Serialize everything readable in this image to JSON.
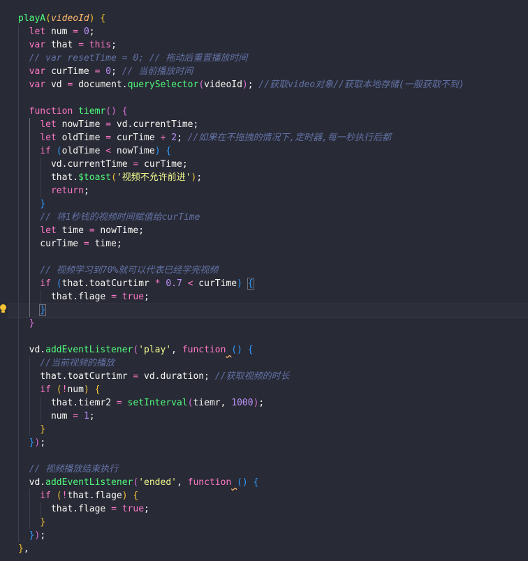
{
  "editor": {
    "code_lines": [
      [
        [
          "fn",
          "playA"
        ],
        [
          "bk-y",
          "("
        ],
        [
          "prm",
          "videoId"
        ],
        [
          "bk-y",
          ")"
        ],
        [
          "pn",
          " "
        ],
        [
          "bk-y",
          "{"
        ]
      ],
      [
        [
          "pn",
          "  "
        ],
        [
          "kw",
          "let"
        ],
        [
          "pn",
          " num "
        ],
        [
          "op",
          "="
        ],
        [
          "pn",
          " "
        ],
        [
          "num",
          "0"
        ],
        [
          "pn",
          ";"
        ]
      ],
      [
        [
          "pn",
          "  "
        ],
        [
          "kw",
          "var"
        ],
        [
          "pn",
          " that "
        ],
        [
          "op",
          "="
        ],
        [
          "pn",
          " "
        ],
        [
          "kw",
          "this"
        ],
        [
          "pn",
          ";"
        ]
      ],
      [
        [
          "pn",
          "  "
        ],
        [
          "cm",
          "// var resetTime = 0; // 拖动后重置播放时间"
        ]
      ],
      [
        [
          "pn",
          "  "
        ],
        [
          "kw",
          "var"
        ],
        [
          "pn",
          " curTime "
        ],
        [
          "op",
          "="
        ],
        [
          "pn",
          " "
        ],
        [
          "num",
          "0"
        ],
        [
          "pn",
          "; "
        ],
        [
          "cm",
          "// 当前播放时间"
        ]
      ],
      [
        [
          "pn",
          "  "
        ],
        [
          "kw",
          "var"
        ],
        [
          "pn",
          " vd "
        ],
        [
          "op",
          "="
        ],
        [
          "pn",
          " document."
        ],
        [
          "met",
          "querySelector"
        ],
        [
          "bk-p",
          "("
        ],
        [
          "pn",
          "videoId"
        ],
        [
          "bk-p",
          ")"
        ],
        [
          "pn",
          "; "
        ],
        [
          "cm",
          "//获取video对象//获取本地存储(一般获取不到)"
        ]
      ],
      [],
      [
        [
          "pn",
          "  "
        ],
        [
          "kw",
          "function"
        ],
        [
          "pn",
          " "
        ],
        [
          "fn",
          "tiemr"
        ],
        [
          "bk-p",
          "()"
        ],
        [
          "pn",
          " "
        ],
        [
          "bk-p",
          "{"
        ]
      ],
      [
        [
          "pn",
          "    "
        ],
        [
          "kw",
          "let"
        ],
        [
          "pn",
          " nowTime "
        ],
        [
          "op",
          "="
        ],
        [
          "pn",
          " vd."
        ],
        [
          "pr",
          "currentTime"
        ],
        [
          "pn",
          ";"
        ]
      ],
      [
        [
          "pn",
          "    "
        ],
        [
          "kw",
          "let"
        ],
        [
          "pn",
          " oldTime "
        ],
        [
          "op",
          "="
        ],
        [
          "pn",
          " curTime "
        ],
        [
          "op",
          "+"
        ],
        [
          "pn",
          " "
        ],
        [
          "num",
          "2"
        ],
        [
          "pn",
          "; "
        ],
        [
          "cm",
          "//如果在不拖拽的情况下,定时器,每一秒执行后都"
        ]
      ],
      [
        [
          "pn",
          "    "
        ],
        [
          "kw",
          "if"
        ],
        [
          "pn",
          " "
        ],
        [
          "bk-b",
          "("
        ],
        [
          "pn",
          "oldTime "
        ],
        [
          "op",
          "<"
        ],
        [
          "pn",
          " nowTime"
        ],
        [
          "bk-b",
          ")"
        ],
        [
          "pn",
          " "
        ],
        [
          "bk-b",
          "{"
        ]
      ],
      [
        [
          "pn",
          "      vd."
        ],
        [
          "pr",
          "currentTime"
        ],
        [
          "pn",
          " "
        ],
        [
          "op",
          "="
        ],
        [
          "pn",
          " curTime;"
        ]
      ],
      [
        [
          "pn",
          "      that."
        ],
        [
          "met",
          "$toast"
        ],
        [
          "bk-y",
          "("
        ],
        [
          "str",
          "'视频不允许前进'"
        ],
        [
          "bk-y",
          ")"
        ],
        [
          "pn",
          ";"
        ]
      ],
      [
        [
          "pn",
          "      "
        ],
        [
          "kw",
          "return"
        ],
        [
          "pn",
          ";"
        ]
      ],
      [
        [
          "pn",
          "    "
        ],
        [
          "bk-b",
          "}"
        ]
      ],
      [
        [
          "pn",
          "    "
        ],
        [
          "cm",
          "// 将1秒钱的视频时间赋值给curTime"
        ]
      ],
      [
        [
          "pn",
          "    "
        ],
        [
          "kw",
          "let"
        ],
        [
          "pn",
          " time "
        ],
        [
          "op",
          "="
        ],
        [
          "pn",
          " nowTime;"
        ]
      ],
      [
        [
          "pn",
          "    curTime "
        ],
        [
          "op",
          "="
        ],
        [
          "pn",
          " time;"
        ]
      ],
      [],
      [
        [
          "pn",
          "    "
        ],
        [
          "cm",
          "// 视频学习到70%就可以代表已经学完视频"
        ]
      ],
      [
        [
          "pn",
          "    "
        ],
        [
          "kw",
          "if"
        ],
        [
          "pn",
          " "
        ],
        [
          "bk-b",
          "("
        ],
        [
          "pn",
          "that."
        ],
        [
          "pr",
          "toatCurtimr"
        ],
        [
          "pn",
          " "
        ],
        [
          "op",
          "*"
        ],
        [
          "pn",
          " "
        ],
        [
          "num",
          "0.7"
        ],
        [
          "pn",
          " "
        ],
        [
          "op",
          "<"
        ],
        [
          "pn",
          " curTime"
        ],
        [
          "bk-b",
          ")"
        ],
        [
          "pn",
          " "
        ],
        [
          "bk-b bm",
          "{"
        ]
      ],
      [
        [
          "pn",
          "      that."
        ],
        [
          "pr",
          "flage"
        ],
        [
          "pn",
          " "
        ],
        [
          "op",
          "="
        ],
        [
          "pn",
          " "
        ],
        [
          "kw",
          "true"
        ],
        [
          "pn",
          ";"
        ]
      ],
      [
        [
          "pn",
          "    "
        ],
        [
          "bk-b bm",
          "}"
        ]
      ],
      [
        [
          "pn",
          "  "
        ],
        [
          "bk-p",
          "}"
        ]
      ],
      [],
      [
        [
          "pn",
          "  vd."
        ],
        [
          "met",
          "addEventListener"
        ],
        [
          "bk-p",
          "("
        ],
        [
          "str",
          "'play'"
        ],
        [
          "pn",
          ", "
        ],
        [
          "kw",
          "function"
        ],
        [
          "pn squiggle",
          " "
        ],
        [
          "bk-b",
          "()"
        ],
        [
          "pn",
          " "
        ],
        [
          "bk-b",
          "{"
        ]
      ],
      [
        [
          "pn",
          "    "
        ],
        [
          "cm",
          "//当前视频的播放"
        ]
      ],
      [
        [
          "pn",
          "    that."
        ],
        [
          "pr",
          "toatCurtimr"
        ],
        [
          "pn",
          " "
        ],
        [
          "op",
          "="
        ],
        [
          "pn",
          " vd."
        ],
        [
          "pr",
          "duration"
        ],
        [
          "pn",
          "; "
        ],
        [
          "cm",
          "//获取视频的时长"
        ]
      ],
      [
        [
          "pn",
          "    "
        ],
        [
          "kw",
          "if"
        ],
        [
          "pn",
          " "
        ],
        [
          "bk-y",
          "("
        ],
        [
          "op",
          "!"
        ],
        [
          "pn",
          "num"
        ],
        [
          "bk-y",
          ")"
        ],
        [
          "pn",
          " "
        ],
        [
          "bk-y",
          "{"
        ]
      ],
      [
        [
          "pn",
          "      that."
        ],
        [
          "pr",
          "tiemr2"
        ],
        [
          "pn",
          " "
        ],
        [
          "op",
          "="
        ],
        [
          "pn",
          " "
        ],
        [
          "met",
          "setInterval"
        ],
        [
          "bk-p",
          "("
        ],
        [
          "pn",
          "tiemr, "
        ],
        [
          "num",
          "1000"
        ],
        [
          "bk-p",
          ")"
        ],
        [
          "pn",
          ";"
        ]
      ],
      [
        [
          "pn",
          "      num "
        ],
        [
          "op",
          "="
        ],
        [
          "pn",
          " "
        ],
        [
          "num",
          "1"
        ],
        [
          "pn",
          ";"
        ]
      ],
      [
        [
          "pn",
          "    "
        ],
        [
          "bk-y",
          "}"
        ]
      ],
      [
        [
          "pn",
          "  "
        ],
        [
          "bk-b",
          "}"
        ],
        [
          "bk-p",
          ")"
        ],
        [
          "pn",
          ";"
        ]
      ],
      [],
      [
        [
          "pn",
          "  "
        ],
        [
          "cm",
          "// 视频播放结束执行"
        ]
      ],
      [
        [
          "pn",
          "  vd."
        ],
        [
          "met",
          "addEventListener"
        ],
        [
          "bk-p",
          "("
        ],
        [
          "str",
          "'ended'"
        ],
        [
          "pn",
          ", "
        ],
        [
          "kw",
          "function"
        ],
        [
          "pn squiggle",
          " "
        ],
        [
          "bk-b",
          "()"
        ],
        [
          "pn",
          " "
        ],
        [
          "bk-b",
          "{"
        ]
      ],
      [
        [
          "pn",
          "    "
        ],
        [
          "kw",
          "if"
        ],
        [
          "pn",
          " "
        ],
        [
          "bk-y",
          "("
        ],
        [
          "op",
          "!"
        ],
        [
          "pn",
          "that."
        ],
        [
          "pr",
          "flage"
        ],
        [
          "bk-y",
          ")"
        ],
        [
          "pn",
          " "
        ],
        [
          "bk-y",
          "{"
        ]
      ],
      [
        [
          "pn",
          "      that."
        ],
        [
          "pr",
          "flage"
        ],
        [
          "pn",
          " "
        ],
        [
          "op",
          "="
        ],
        [
          "pn",
          " "
        ],
        [
          "kw",
          "true"
        ],
        [
          "pn",
          ";"
        ]
      ],
      [
        [
          "pn",
          "    "
        ],
        [
          "bk-y",
          "}"
        ]
      ],
      [
        [
          "pn",
          "  "
        ],
        [
          "bk-b",
          "}"
        ],
        [
          "bk-p",
          ")"
        ],
        [
          "pn",
          ";"
        ]
      ],
      [
        [
          "bk-y",
          "}"
        ],
        [
          "pn",
          ","
        ]
      ]
    ]
  }
}
